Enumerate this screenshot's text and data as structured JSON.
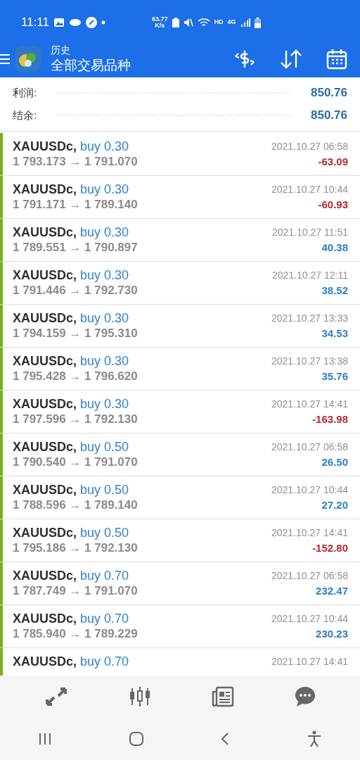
{
  "status_bar": {
    "time": "11:11",
    "speed": "63.77",
    "speed_unit": "K/s",
    "hd": "HD",
    "network": "4G"
  },
  "header": {
    "title": "历史",
    "subtitle": "全部交易品种"
  },
  "summary": [
    {
      "label": "利润:",
      "value": "850.76"
    },
    {
      "label": "结余:",
      "value": "850.76"
    }
  ],
  "deals": [
    {
      "symbol": "XAUUSDc,",
      "type": "buy 0.30",
      "time": "2021.10.27 06:58",
      "prices": "1 793.173 → 1 791.070",
      "profit": "-63.09",
      "loss": true
    },
    {
      "symbol": "XAUUSDc,",
      "type": "buy 0.30",
      "time": "2021.10.27 10:44",
      "prices": "1 791.171 → 1 789.140",
      "profit": "-60.93",
      "loss": true
    },
    {
      "symbol": "XAUUSDc,",
      "type": "buy 0.30",
      "time": "2021.10.27 11:51",
      "prices": "1 789.551 → 1 790.897",
      "profit": "40.38",
      "loss": false
    },
    {
      "symbol": "XAUUSDc,",
      "type": "buy 0.30",
      "time": "2021.10.27 12:11",
      "prices": "1 791.446 → 1 792.730",
      "profit": "38.52",
      "loss": false
    },
    {
      "symbol": "XAUUSDc,",
      "type": "buy 0.30",
      "time": "2021.10.27 13:33",
      "prices": "1 794.159 → 1 795.310",
      "profit": "34.53",
      "loss": false
    },
    {
      "symbol": "XAUUSDc,",
      "type": "buy 0.30",
      "time": "2021.10.27 13:38",
      "prices": "1 795.428 → 1 796.620",
      "profit": "35.76",
      "loss": false
    },
    {
      "symbol": "XAUUSDc,",
      "type": "buy 0.30",
      "time": "2021.10.27 14:41",
      "prices": "1 797.596 → 1 792.130",
      "profit": "-163.98",
      "loss": true
    },
    {
      "symbol": "XAUUSDc,",
      "type": "buy 0.50",
      "time": "2021.10.27 06:58",
      "prices": "1 790.540 → 1 791.070",
      "profit": "26.50",
      "loss": false
    },
    {
      "symbol": "XAUUSDc,",
      "type": "buy 0.50",
      "time": "2021.10.27 10:44",
      "prices": "1 788.596 → 1 789.140",
      "profit": "27.20",
      "loss": false
    },
    {
      "symbol": "XAUUSDc,",
      "type": "buy 0.50",
      "time": "2021.10.27 14:41",
      "prices": "1 795.186 → 1 792.130",
      "profit": "-152.80",
      "loss": true
    },
    {
      "symbol": "XAUUSDc,",
      "type": "buy 0.70",
      "time": "2021.10.27 06:58",
      "prices": "1 787.749 → 1 791.070",
      "profit": "232.47",
      "loss": false
    },
    {
      "symbol": "XAUUSDc,",
      "type": "buy 0.70",
      "time": "2021.10.27 10:44",
      "prices": "1 785.940 → 1 789.229",
      "profit": "230.23",
      "loss": false
    },
    {
      "symbol": "XAUUSDc,",
      "type": "buy 0.70",
      "time": "2021.10.27 14:41"
    }
  ],
  "bottom_nav": [
    {
      "kind": "quotes",
      "selected": false
    },
    {
      "kind": "chart",
      "selected": false
    },
    {
      "kind": "news",
      "selected": false
    },
    {
      "kind": "chat",
      "selected": false
    }
  ]
}
